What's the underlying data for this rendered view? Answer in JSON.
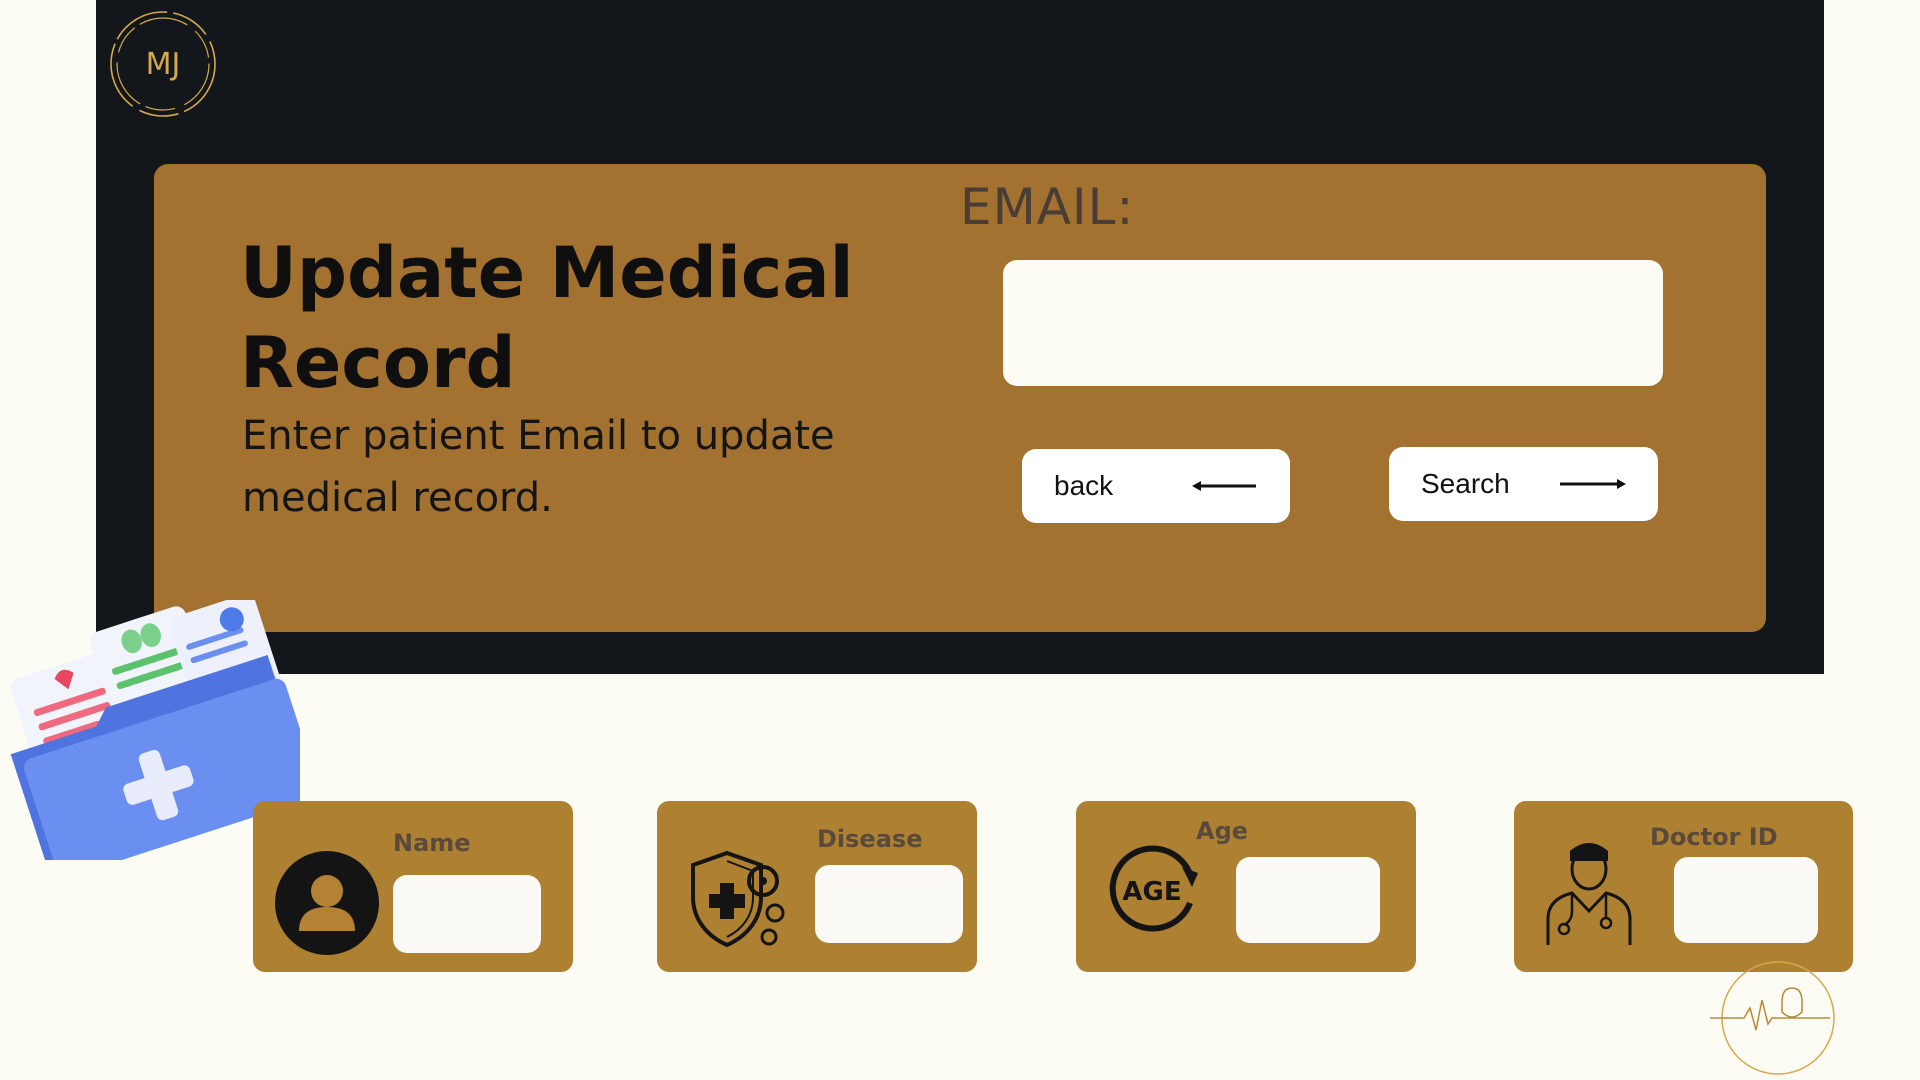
{
  "brand": {
    "logo_text": "MJ"
  },
  "header": {
    "title": "Update Medical Record",
    "subtitle": "Enter patient Email to update medical record."
  },
  "email": {
    "label": "EMAIL:",
    "value": "",
    "placeholder": ""
  },
  "buttons": {
    "back_label": "back",
    "search_label": "Search"
  },
  "fields": [
    {
      "label": "Name",
      "icon": "user-avatar-icon",
      "value": ""
    },
    {
      "label": "Disease",
      "icon": "virus-shield-icon",
      "value": ""
    },
    {
      "label": "Age",
      "icon": "age-cycle-icon",
      "icon_text": "AGE",
      "value": ""
    },
    {
      "label": "Doctor ID",
      "icon": "doctor-icon",
      "value": ""
    }
  ],
  "colors": {
    "page_bg": "#fdfcf4",
    "dark_panel": "#13171b",
    "card_brown": "#a37130",
    "field_card": "#ad8032",
    "gold": "#d4a94a",
    "folder_blue": "#6a8ff0"
  }
}
